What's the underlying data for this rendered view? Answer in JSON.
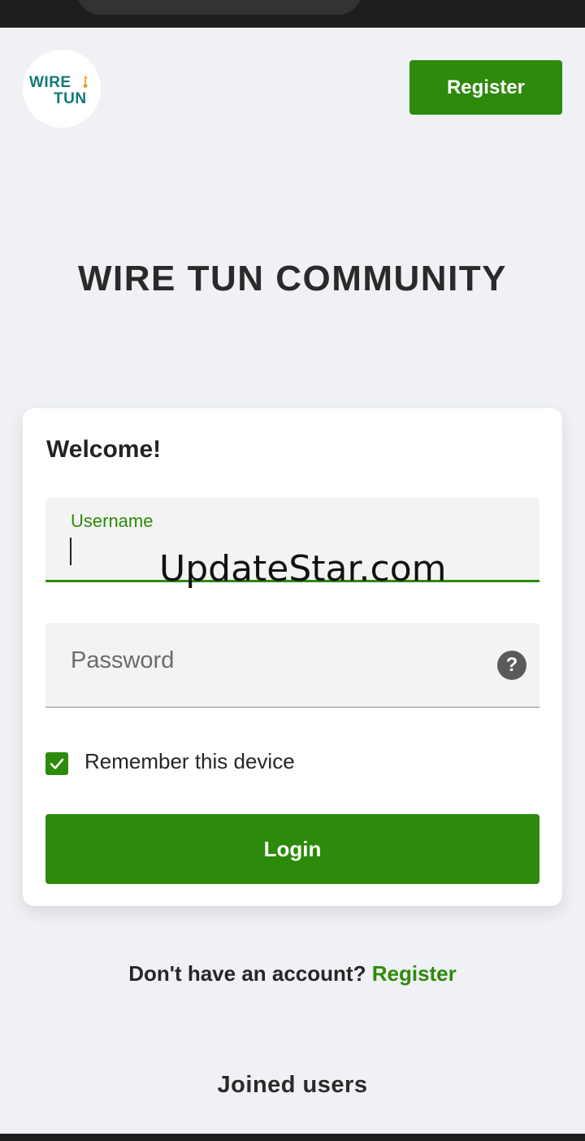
{
  "header": {
    "logo": {
      "line1": "WIRE",
      "line2": "TUN",
      "icon": "key-icon",
      "color": "#137a78"
    },
    "register_label": "Register"
  },
  "page_title": "WIRE TUN COMMUNITY",
  "login_card": {
    "welcome": "Welcome!",
    "username": {
      "label": "Username",
      "value": ""
    },
    "password": {
      "placeholder": "Password",
      "help_icon": "question-circle-icon",
      "help_glyph": "?"
    },
    "remember": {
      "label": "Remember this device",
      "checked": true,
      "icon": "check-icon"
    },
    "login_label": "Login"
  },
  "watermark": "UpdateStar.com",
  "footer": {
    "prompt": "Don't have an account?",
    "register_link": "Register",
    "joined_users": "Joined users"
  },
  "colors": {
    "accent": "#2e8a0a",
    "background": "#eff1f5",
    "logo_teal": "#137a78"
  }
}
